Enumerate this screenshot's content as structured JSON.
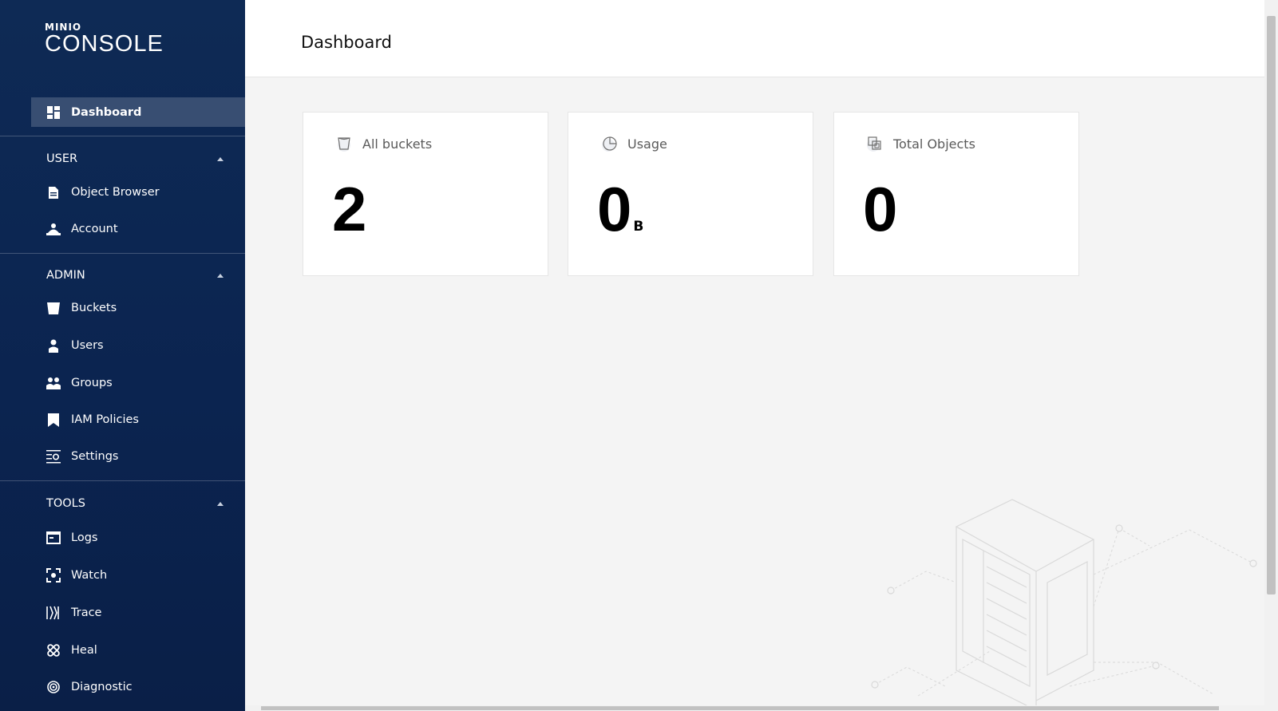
{
  "sidebar": {
    "logo": {
      "brand": "MINIO",
      "product": "CONSOLE"
    },
    "active_item": "Dashboard",
    "sections": [
      {
        "header": "USER",
        "items": [
          "Object Browser",
          "Account"
        ]
      },
      {
        "header": "ADMIN",
        "items": [
          "Buckets",
          "Users",
          "Groups",
          "IAM Policies",
          "Settings"
        ]
      },
      {
        "header": "TOOLS",
        "items": [
          "Logs",
          "Watch",
          "Trace",
          "Heal",
          "Diagnostic"
        ]
      }
    ]
  },
  "header": {
    "title": "Dashboard"
  },
  "cards": [
    {
      "label": "All buckets",
      "value": "2",
      "unit": ""
    },
    {
      "label": "Usage",
      "value": "0",
      "unit": "B"
    },
    {
      "label": "Total Objects",
      "value": "0",
      "unit": ""
    }
  ],
  "colors": {
    "sidebar_bg": "#0e2a55",
    "active_bg": "#3a5078",
    "main_bg": "#f4f4f4",
    "card_bg": "#ffffff"
  }
}
